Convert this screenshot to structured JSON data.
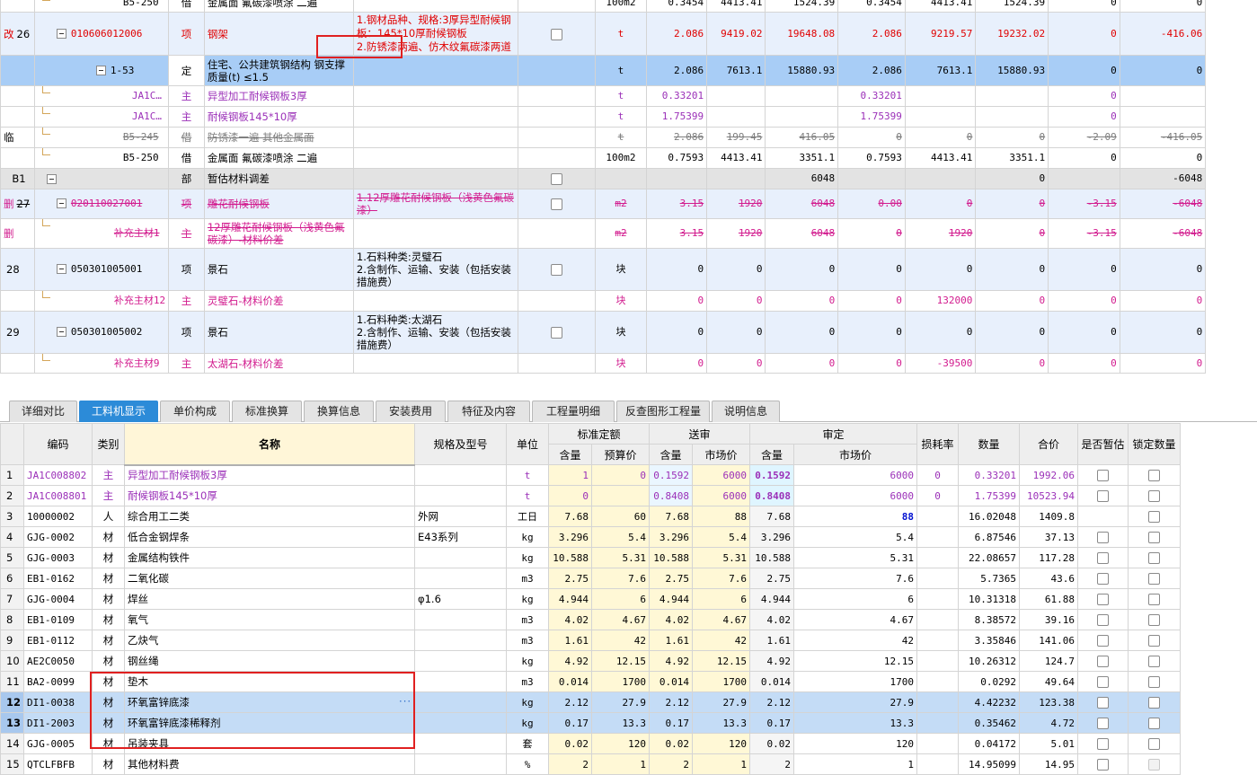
{
  "top_rows": [
    {
      "id": "r0",
      "flag": "",
      "num": "",
      "code": "B5-250",
      "type": "借",
      "name": "金属面 氟碳漆喷涂 二遍",
      "feat": "",
      "unit": "100m2",
      "v": [
        "0.3454",
        "4413.41",
        "1524.39",
        "0.3454",
        "4413.41",
        "1524.39",
        "0",
        "0"
      ]
    },
    {
      "id": "r1",
      "flag": "改",
      "num": "26",
      "code": "010606012006",
      "type": "项",
      "name": "钢架",
      "feat": "1.钢材品种、规格:3厚异型耐候钢板：145*10厚耐候钢板\n2.防锈漆两遍、仿木纹氟碳漆两道",
      "unit": "t",
      "v": [
        "2.086",
        "9419.02",
        "19648.08",
        "2.086",
        "9219.57",
        "19232.02",
        "0",
        "-416.06"
      ]
    },
    {
      "id": "r2",
      "flag": "",
      "num": "",
      "code": "1-53",
      "type": "定",
      "name": "住宅、公共建筑钢结构 钢支撑 质量(t) ≤1.5",
      "feat": "",
      "unit": "t",
      "v": [
        "2.086",
        "7613.1",
        "15880.93",
        "2.086",
        "7613.1",
        "15880.93",
        "0",
        "0"
      ]
    },
    {
      "id": "r3",
      "flag": "",
      "num": "",
      "code": "JA1C…",
      "type": "主",
      "name": "异型加工耐候钢板3厚",
      "feat": "",
      "unit": "t",
      "v": [
        "0.33201",
        "",
        "",
        "0.33201",
        "",
        "",
        "0",
        ""
      ]
    },
    {
      "id": "r4",
      "flag": "",
      "num": "",
      "code": "JA1C…",
      "type": "主",
      "name": "耐候钢板145*10厚",
      "feat": "",
      "unit": "t",
      "v": [
        "1.75399",
        "",
        "",
        "1.75399",
        "",
        "",
        "0",
        ""
      ]
    },
    {
      "id": "r5",
      "flag": "临",
      "num": "",
      "code": "B5-245",
      "type": "借",
      "name": "防锈漆一遍 其他金属面",
      "feat": "",
      "unit": "t",
      "v": [
        "2.086",
        "199.45",
        "416.05",
        "0",
        "0",
        "0",
        "-2.09",
        "-416.05"
      ]
    },
    {
      "id": "r6",
      "flag": "",
      "num": "",
      "code": "B5-250",
      "type": "借",
      "name": "金属面 氟碳漆喷涂 二遍",
      "feat": "",
      "unit": "100m2",
      "v": [
        "0.7593",
        "4413.41",
        "3351.1",
        "0.7593",
        "4413.41",
        "3351.1",
        "0",
        "0"
      ]
    },
    {
      "id": "r7",
      "flag": "",
      "num": "B1",
      "code": "",
      "type": "部",
      "name": "暂估材料调差",
      "feat": "",
      "unit": "",
      "v": [
        "",
        "",
        "6048",
        "",
        "",
        "0",
        "",
        "-6048"
      ]
    },
    {
      "id": "r8",
      "flag": "删",
      "num": "27",
      "code": "020110027001",
      "type": "项",
      "name": "雕花耐候钢板",
      "feat": "1.12厚雕花耐候钢板（浅黄色氟碳漆）",
      "unit": "m2",
      "v": [
        "3.15",
        "1920",
        "6048",
        "0.00",
        "0",
        "0",
        "-3.15",
        "-6048"
      ]
    },
    {
      "id": "r9",
      "flag": "删",
      "num": "",
      "code": "补充主材1",
      "type": "主",
      "name": "12厚雕花耐候钢板（浅黄色氟碳漆）-材料价差",
      "feat": "",
      "unit": "m2",
      "v": [
        "3.15",
        "1920",
        "6048",
        "0",
        "1920",
        "0",
        "-3.15",
        "-6048"
      ]
    },
    {
      "id": "r10",
      "flag": "",
      "num": "28",
      "code": "050301005001",
      "type": "项",
      "name": "景石",
      "feat": "1.石料种类:灵璧石\n2.含制作、运输、安装（包括安装措施费）",
      "unit": "块",
      "v": [
        "0",
        "0",
        "0",
        "0",
        "0",
        "0",
        "0",
        "0"
      ]
    },
    {
      "id": "r11",
      "flag": "",
      "num": "",
      "code": "补充主材12",
      "type": "主",
      "name": "灵璧石-材料价差",
      "feat": "",
      "unit": "块",
      "v": [
        "0",
        "0",
        "0",
        "0",
        "132000",
        "0",
        "0",
        "0"
      ]
    },
    {
      "id": "r12",
      "flag": "",
      "num": "29",
      "code": "050301005002",
      "type": "项",
      "name": "景石",
      "feat": "1.石料种类:太湖石\n2.含制作、运输、安装（包括安装措施费）",
      "unit": "块",
      "v": [
        "0",
        "0",
        "0",
        "0",
        "0",
        "0",
        "0",
        "0"
      ]
    },
    {
      "id": "r13",
      "flag": "",
      "num": "",
      "code": "补充主材9",
      "type": "主",
      "name": "太湖石-材料价差",
      "feat": "",
      "unit": "块",
      "v": [
        "0",
        "0",
        "0",
        "0",
        "-39500",
        "0",
        "0",
        "0"
      ]
    }
  ],
  "tabs": [
    "详细对比",
    "工料机显示",
    "单价构成",
    "标准换算",
    "换算信息",
    "安装费用",
    "特征及内容",
    "工程量明细",
    "反查图形工程量",
    "说明信息"
  ],
  "active_tab": 1,
  "bottom_headers": {
    "code": "编码",
    "type": "类别",
    "name": "名称",
    "spec": "规格及型号",
    "unit": "单位",
    "std": "标准定额",
    "send": "送审",
    "audit": "审定",
    "qty": "含量",
    "budget_price": "预算价",
    "market_price": "市场价",
    "loss": "损耗率",
    "amount": "数量",
    "total": "合价",
    "estimate": "是否暂估",
    "lock": "锁定数量"
  },
  "bottom_rows": [
    {
      "n": "1",
      "code": "JA1C008802",
      "type": "主",
      "name": "异型加工耐候钢板3厚",
      "spec": "",
      "unit": "t",
      "sq": "1",
      "sp": "0",
      "dq": "0.1592",
      "dp": "6000",
      "aq": "0.1592",
      "ap": "6000",
      "loss": "0",
      "amt": "0.33201",
      "tot": "1992.06",
      "main": true
    },
    {
      "n": "2",
      "code": "JA1C008801",
      "type": "主",
      "name": "耐候钢板145*10厚",
      "spec": "",
      "unit": "t",
      "sq": "0",
      "sp": "",
      "dq": "0.8408",
      "dp": "6000",
      "aq": "0.8408",
      "ap": "6000",
      "loss": "0",
      "amt": "1.75399",
      "tot": "10523.94",
      "main": true
    },
    {
      "n": "3",
      "code": "10000002",
      "type": "人",
      "name": "综合用工二类",
      "spec": "外网",
      "unit": "工日",
      "sq": "7.68",
      "sp": "60",
      "dq": "7.68",
      "dp": "88",
      "aq": "7.68",
      "ap": "88",
      "loss": "",
      "amt": "16.02048",
      "tot": "1409.8",
      "labor": true
    },
    {
      "n": "4",
      "code": "GJG-0002",
      "type": "材",
      "name": "低合金钢焊条",
      "spec": "E43系列",
      "unit": "kg",
      "sq": "3.296",
      "sp": "5.4",
      "dq": "3.296",
      "dp": "5.4",
      "aq": "3.296",
      "ap": "5.4",
      "loss": "",
      "amt": "6.87546",
      "tot": "37.13"
    },
    {
      "n": "5",
      "code": "GJG-0003",
      "type": "材",
      "name": "金属结构铁件",
      "spec": "",
      "unit": "kg",
      "sq": "10.588",
      "sp": "5.31",
      "dq": "10.588",
      "dp": "5.31",
      "aq": "10.588",
      "ap": "5.31",
      "loss": "",
      "amt": "22.08657",
      "tot": "117.28"
    },
    {
      "n": "6",
      "code": "EB1-0162",
      "type": "材",
      "name": "二氧化碳",
      "spec": "",
      "unit": "m3",
      "sq": "2.75",
      "sp": "7.6",
      "dq": "2.75",
      "dp": "7.6",
      "aq": "2.75",
      "ap": "7.6",
      "loss": "",
      "amt": "5.7365",
      "tot": "43.6"
    },
    {
      "n": "7",
      "code": "GJG-0004",
      "type": "材",
      "name": "焊丝",
      "spec": "φ1.6",
      "unit": "kg",
      "sq": "4.944",
      "sp": "6",
      "dq": "4.944",
      "dp": "6",
      "aq": "4.944",
      "ap": "6",
      "loss": "",
      "amt": "10.31318",
      "tot": "61.88"
    },
    {
      "n": "8",
      "code": "EB1-0109",
      "type": "材",
      "name": "氧气",
      "spec": "",
      "unit": "m3",
      "sq": "4.02",
      "sp": "4.67",
      "dq": "4.02",
      "dp": "4.67",
      "aq": "4.02",
      "ap": "4.67",
      "loss": "",
      "amt": "8.38572",
      "tot": "39.16"
    },
    {
      "n": "9",
      "code": "EB1-0112",
      "type": "材",
      "name": "乙炔气",
      "spec": "",
      "unit": "m3",
      "sq": "1.61",
      "sp": "42",
      "dq": "1.61",
      "dp": "42",
      "aq": "1.61",
      "ap": "42",
      "loss": "",
      "amt": "3.35846",
      "tot": "141.06"
    },
    {
      "n": "10",
      "code": "AE2C0050",
      "type": "材",
      "name": "钢丝绳",
      "spec": "",
      "unit": "kg",
      "sq": "4.92",
      "sp": "12.15",
      "dq": "4.92",
      "dp": "12.15",
      "aq": "4.92",
      "ap": "12.15",
      "loss": "",
      "amt": "10.26312",
      "tot": "124.7"
    },
    {
      "n": "11",
      "code": "BA2-0099",
      "type": "材",
      "name": "垫木",
      "spec": "",
      "unit": "m3",
      "sq": "0.014",
      "sp": "1700",
      "dq": "0.014",
      "dp": "1700",
      "aq": "0.014",
      "ap": "1700",
      "loss": "",
      "amt": "0.0292",
      "tot": "49.64"
    },
    {
      "n": "12",
      "code": "DI1-0038",
      "type": "材",
      "name": "环氧富锌底漆",
      "spec": "",
      "unit": "kg",
      "sq": "2.12",
      "sp": "27.9",
      "dq": "2.12",
      "dp": "27.9",
      "aq": "2.12",
      "ap": "27.9",
      "loss": "",
      "amt": "4.42232",
      "tot": "123.38",
      "sel": true,
      "dots": "···"
    },
    {
      "n": "13",
      "code": "DI1-2003",
      "type": "材",
      "name": "环氧富锌底漆稀释剂",
      "spec": "",
      "unit": "kg",
      "sq": "0.17",
      "sp": "13.3",
      "dq": "0.17",
      "dp": "13.3",
      "aq": "0.17",
      "ap": "13.3",
      "loss": "",
      "amt": "0.35462",
      "tot": "4.72",
      "sel": true
    },
    {
      "n": "14",
      "code": "GJG-0005",
      "type": "材",
      "name": "吊装夹具",
      "spec": "",
      "unit": "套",
      "sq": "0.02",
      "sp": "120",
      "dq": "0.02",
      "dp": "120",
      "aq": "0.02",
      "ap": "120",
      "loss": "",
      "amt": "0.04172",
      "tot": "5.01"
    },
    {
      "n": "15",
      "code": "QTCLFBFB",
      "type": "材",
      "name": "其他材料费",
      "spec": "",
      "unit": "%",
      "sq": "2",
      "sp": "1",
      "dq": "2",
      "dp": "1",
      "aq": "2",
      "ap": "1",
      "loss": "",
      "amt": "14.95099",
      "tot": "14.95",
      "disabled": true
    }
  ]
}
